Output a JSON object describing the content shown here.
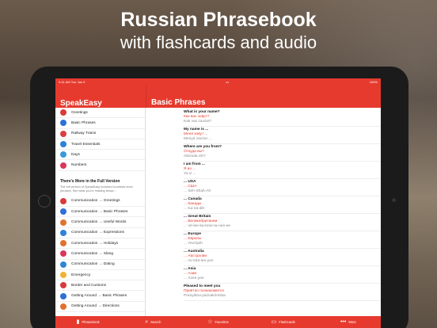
{
  "headline": {
    "line1": "Russian Phrasebook",
    "line2": "with flashcards and audio"
  },
  "status": {
    "left": "9:41 AM   Tue Jan 9",
    "center": "•••",
    "right": "100%"
  },
  "app": {
    "title": "SpeakEasy",
    "section_title": "Basic Phrases"
  },
  "colors": {
    "accent": "#e63a2e"
  },
  "sidebar": {
    "items": [
      {
        "label": "Greetings",
        "icon": "speech-bubble-icon",
        "color": "#d93a3a"
      },
      {
        "label": "Basic Phrases",
        "icon": "chat-icon",
        "color": "#2e6fd8"
      },
      {
        "label": "Railway Trains",
        "icon": "train-icon",
        "color": "#d94040"
      },
      {
        "label": "Travel Essentials",
        "icon": "luggage-icon",
        "color": "#2e84d8"
      },
      {
        "label": "Days",
        "icon": "calendar-icon",
        "color": "#3a9ad8"
      },
      {
        "label": "Numbers",
        "icon": "numbers-icon",
        "color": "#d9365a"
      }
    ],
    "full_version_title": "There's More in the Full Version",
    "full_version_desc": "The full version of SpeakEasy includes hundreds more phrases. See what you're missing below ↓",
    "locked": [
      {
        "label": "Communication → Greetings",
        "icon": "speech-bubble-icon",
        "color": "#d93a3a"
      },
      {
        "label": "Communication → Basic Phrases",
        "icon": "chat-icon",
        "color": "#2e6fd8"
      },
      {
        "label": "Communication → Useful Words",
        "icon": "book-icon",
        "color": "#e0722e"
      },
      {
        "label": "Communication → Expressions",
        "icon": "star-icon",
        "color": "#2e84d8"
      },
      {
        "label": "Communication → Holidays",
        "icon": "gift-icon",
        "color": "#e0722e"
      },
      {
        "label": "Communication → Slang",
        "icon": "megaphone-icon",
        "color": "#d9365a"
      },
      {
        "label": "Communication → Dating",
        "icon": "heart-icon",
        "color": "#2e84d8"
      },
      {
        "label": "Emergency",
        "icon": "alert-icon",
        "color": "#f2b233"
      },
      {
        "label": "Border and Customs",
        "icon": "passport-icon",
        "color": "#d93a3a"
      },
      {
        "label": "Getting Around → Basic Phrases",
        "icon": "map-icon",
        "color": "#2e6fd8"
      },
      {
        "label": "Getting Around → Directions",
        "icon": "compass-icon",
        "color": "#e0722e"
      }
    ]
  },
  "phrases": [
    {
      "en": "What is your name?",
      "ru": "Как вас зовут?",
      "tr": "Kak vas zavóot?"
    },
    {
      "en": "My name is ...",
      "ru": "Меня зовут ...",
      "tr": "Menyá zavóot ..."
    },
    {
      "en": "Where are you from?",
      "ru": "Откуда вы?",
      "tr": "Atkóoda vih?"
    },
    {
      "en": "I am from ...",
      "ru": "Я из ...",
      "tr": "Ya iz ..."
    },
    {
      "en": "... USA",
      "ru": "... США",
      "tr": "... Seh-Shah-Ah"
    },
    {
      "en": "... Canada",
      "ru": "... Канады",
      "tr": "... Ka-ná-dih"
    },
    {
      "en": "... Great Britain",
      "ru": "... Великобритании",
      "tr": "... Ve-lee-ka-bree-ta-nee-ee"
    },
    {
      "en": "... Europe",
      "ru": "... Европы",
      "tr": "... Yevrópih"
    },
    {
      "en": "... Australia",
      "ru": "... Австралии",
      "tr": "... Av-strá-lee-yee"
    },
    {
      "en": "... Asia",
      "ru": "... Азии",
      "tr": "... Ázee-yee"
    },
    {
      "en": "Pleased to meet you",
      "ru": "Приятно познакомится",
      "tr": "Preeyátna paznakómitsa"
    }
  ],
  "tabs": [
    {
      "label": "Phrasebook",
      "icon": "book-icon",
      "glyph": "▮"
    },
    {
      "label": "Search",
      "icon": "search-icon",
      "glyph": "⌕"
    },
    {
      "label": "Favorites",
      "icon": "star-icon",
      "glyph": "☆"
    },
    {
      "label": "Flashcards",
      "icon": "cards-icon",
      "glyph": "▭"
    },
    {
      "label": "More",
      "icon": "more-icon",
      "glyph": "•••"
    }
  ]
}
